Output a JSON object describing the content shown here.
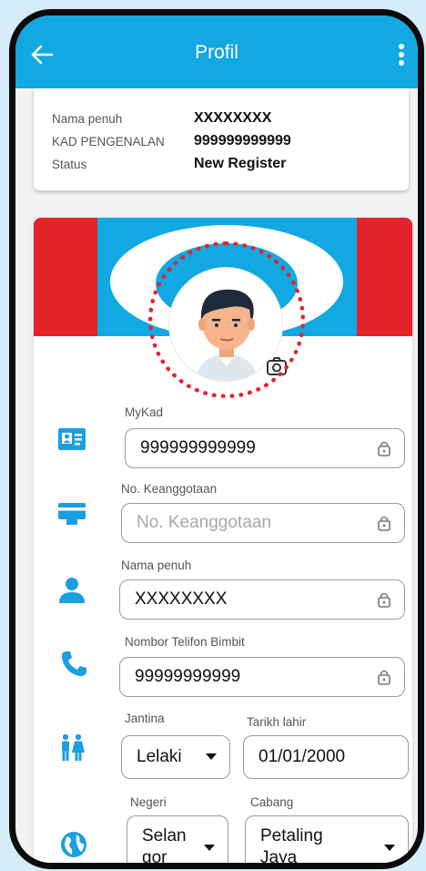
{
  "header": {
    "title": "Profil",
    "back_icon": "arrow-left-icon",
    "menu_icon": "more-vert-icon"
  },
  "summary": {
    "rows": [
      {
        "label": "Nama penuh",
        "value": "XXXXXXXX"
      },
      {
        "label": "KAD PENGENALAN",
        "value": "999999999999"
      },
      {
        "label": "Status",
        "value": "New Register"
      }
    ]
  },
  "form": {
    "mykad": {
      "label": "MyKad",
      "value": "999999999999",
      "icon": "id-card-icon"
    },
    "membership": {
      "label": "No. Keanggotaan",
      "placeholder": "No. Keanggotaan",
      "icon": "membership-card-icon"
    },
    "fullname": {
      "label": "Nama penuh",
      "value": "XXXXXXXX",
      "icon": "person-icon"
    },
    "phone": {
      "label": "Nombor Telifon Bimbit",
      "value": "99999999999",
      "icon": "phone-icon"
    },
    "gender": {
      "label": "Jantina",
      "value": "Lelaki",
      "icon": "gender-icon"
    },
    "dob": {
      "label": "Tarikh lahir",
      "value": "01/01/2000"
    },
    "state": {
      "label": "Negeri",
      "line1": "Selan",
      "line2": "gor",
      "icon": "globe-icon"
    },
    "branch": {
      "label": "Cabang",
      "line1": "Petaling",
      "line2": "Jaya"
    }
  },
  "colors": {
    "primary": "#12a8e2",
    "accent_red": "#e3242b",
    "icon_blue": "#1a9fe0"
  }
}
